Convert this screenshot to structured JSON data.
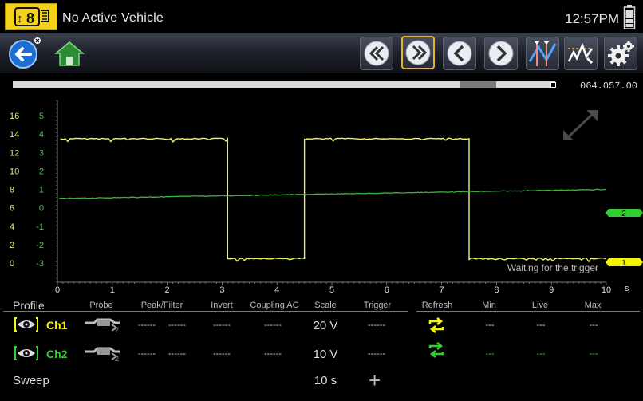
{
  "status": {
    "title": "No Active Vehicle",
    "time": "12:57PM"
  },
  "toolbar": {
    "buttons": [
      {
        "name": "back-button",
        "icon": "back-arrow-icon"
      },
      {
        "name": "home-button",
        "icon": "home-icon"
      },
      {
        "name": "rewind-button",
        "icon": "fast-reverse-icon"
      },
      {
        "name": "fast-forward-button",
        "icon": "fast-forward-icon",
        "active": true
      },
      {
        "name": "step-back-button",
        "icon": "step-back-icon"
      },
      {
        "name": "step-forward-button",
        "icon": "step-forward-icon"
      },
      {
        "name": "cursor-button",
        "icon": "cursors-icon"
      },
      {
        "name": "trigger-tool-button",
        "icon": "waveform-tool-icon"
      },
      {
        "name": "settings-button",
        "icon": "gear-icon"
      }
    ]
  },
  "timeline": {
    "readout": "064.057.00",
    "view_fraction": 0.93
  },
  "scope": {
    "left_axis_labels": [
      "16",
      "14",
      "12",
      "10",
      "8",
      "6",
      "4",
      "2",
      "0"
    ],
    "right_axis_labels": [
      "5",
      "4",
      "3",
      "2",
      "1",
      "0",
      "-1",
      "-2",
      "-3"
    ],
    "x_labels": [
      "0",
      "1",
      "2",
      "3",
      "4",
      "5",
      "6",
      "7",
      "8",
      "9",
      "10"
    ],
    "x_unit": "s",
    "status_message": "Waiting for the trigger",
    "ch1_marker": "1",
    "ch2_marker": "2",
    "colors": {
      "ch1": "#f0f06a",
      "ch2": "#3db33d",
      "grid": "#555555",
      "ch1_marker": "#f5f500",
      "ch2_marker": "#33cc33"
    },
    "ch1_trace": {
      "high_v": 13.5,
      "low_v": 0.5,
      "transitions_s": [
        3.1,
        4.5,
        7.5
      ]
    },
    "ch2_trace": {
      "start_v": 0.5,
      "end_v": 1.0
    }
  },
  "table": {
    "profile_label": "Profile",
    "headers": [
      "Probe",
      "Peak/Filter",
      "Invert",
      "Coupling AC",
      "Scale",
      "Trigger"
    ],
    "right_headers": [
      "Refresh",
      "Min",
      "Live",
      "Max"
    ],
    "rows": [
      {
        "name": "Ch1",
        "color": "#f5f500",
        "peak1": "------",
        "peak2": "------",
        "invert": "------",
        "coupling": "------",
        "scale": "20 V",
        "trigger": "------",
        "min": "---",
        "live": "---",
        "max": "---"
      },
      {
        "name": "Ch2",
        "color": "#33cc33",
        "peak1": "------",
        "peak2": "------",
        "invert": "------",
        "coupling": "------",
        "scale": "10 V",
        "trigger": "------",
        "min": "---",
        "live": "---",
        "max": "---"
      }
    ],
    "sweep_label": "Sweep",
    "sweep_value": "10 s",
    "sweep_add": "+"
  }
}
